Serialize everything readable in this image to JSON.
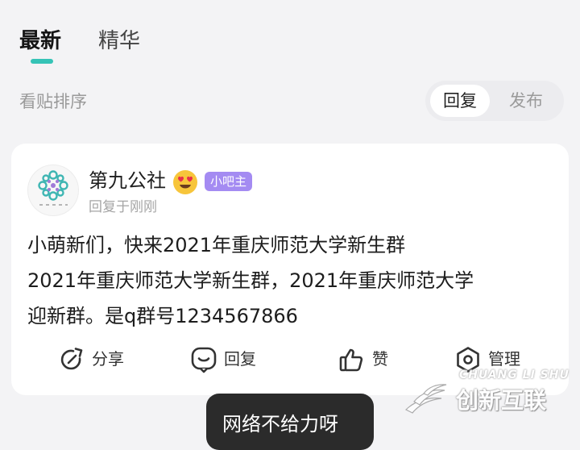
{
  "tabs": {
    "latest": "最新",
    "featured": "精华"
  },
  "sort": {
    "label": "看贴排序",
    "reply": "回复",
    "publish": "发布"
  },
  "post": {
    "username": "第九公社",
    "emoji": "heart-eyes-emoji",
    "badge": "小吧主",
    "meta": "回复于刚刚",
    "content_lines": [
      "小萌新们，快来2021年重庆师范大学新生群",
      "2021年重庆师范大学新生群，2021年重庆师范大学",
      "迎新群。是q群号1234567866"
    ],
    "actions": {
      "share": "分享",
      "reply": "回复",
      "like": "赞",
      "manage": "管理"
    }
  },
  "toast": {
    "text": "网络不给力呀"
  },
  "watermark": {
    "en": "CHUANG LI SHU",
    "zh": "创新互联"
  },
  "colors": {
    "accent": "#35c3b6",
    "badge": "#a48bf2",
    "background": "#f3f3f5"
  }
}
